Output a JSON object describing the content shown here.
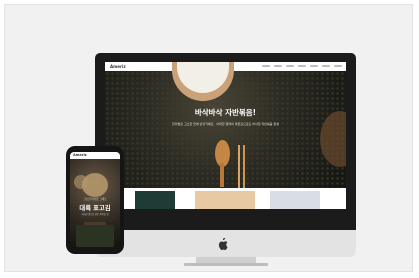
{
  "site": {
    "logo": "Ameriz",
    "hero_title": "바삭바삭 자반볶음!",
    "hero_subtitle": "한다발로 고소한 맛에 반할거예요 · 어떠한 형태의 마른김으로도 바삭한 자반볶음 완성"
  },
  "phone": {
    "logo": "Ameriz",
    "subtitle": "고소한 바삭함 그대로",
    "title": "대륙 표고김",
    "body": "국내산 원초로 만든 바삭한 김"
  },
  "colors": {
    "background": "#f1f1f1",
    "device_black": "#1b1b1b",
    "aluminum": "#e3e3e3"
  },
  "icons": [
    "apple-logo-icon"
  ]
}
